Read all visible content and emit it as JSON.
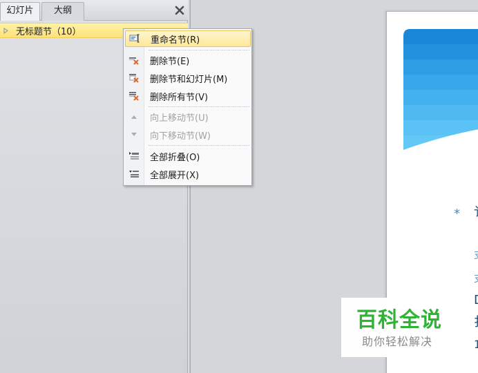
{
  "tabs": {
    "slides": "幻灯片",
    "outline": "大纲"
  },
  "section": {
    "label": "无标题节（10）"
  },
  "context_menu": {
    "rename": "重命名节(R)",
    "delete_section": "删除节(E)",
    "delete_section_and_slides": "删除节和幻灯片(M)",
    "delete_all_sections": "删除所有节(V)",
    "move_up": "向上移动节(U)",
    "move_down": "向下移动节(W)",
    "collapse_all": "全部折叠(O)",
    "expand_all": "全部展开(X)"
  },
  "slide": {
    "bullet": "*",
    "fragments": [
      "讠",
      "支",
      "支",
      "D",
      "扌",
      "1"
    ]
  },
  "watermark": {
    "title": "百科全说",
    "subtitle": "助你轻松解决"
  },
  "colors": {
    "highlight": "#ffe79a",
    "section_row": "#ffe278",
    "slide_accent": "#3a8fd0",
    "watermark_green": "#2fb335"
  }
}
